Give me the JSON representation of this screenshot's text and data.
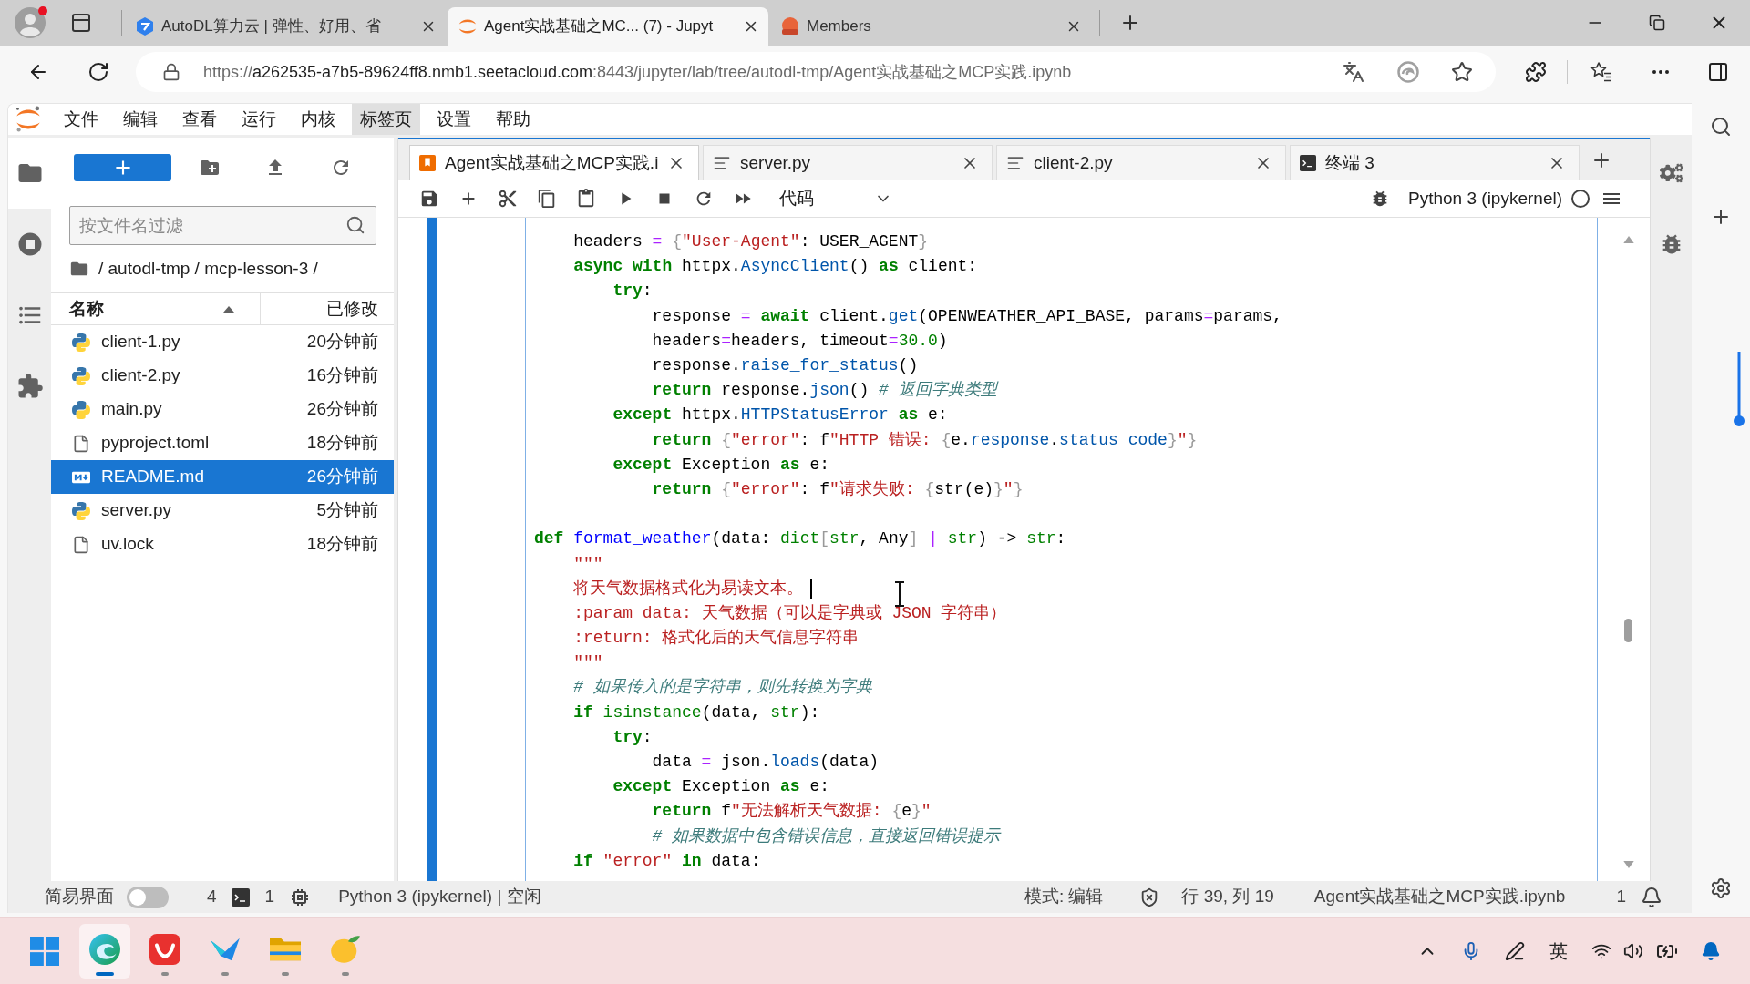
{
  "browser": {
    "tabs": [
      {
        "title": "AutoDL算力云 | 弹性、好用、省",
        "selected": false
      },
      {
        "title": "Agent实战基础之MC... (7) - Jupyt",
        "selected": true
      },
      {
        "title": "Members",
        "selected": false
      }
    ],
    "address": {
      "scheme": "https://",
      "host": "a262535-a7b5-89624ff8.nmb1.seetacloud.com",
      "path": ":8443/jupyter/lab/tree/autodl-tmp/Agent实战基础之MCP实践.ipynb"
    }
  },
  "menu": [
    {
      "label": "文件",
      "highlighted": false
    },
    {
      "label": "编辑",
      "highlighted": false
    },
    {
      "label": "查看",
      "highlighted": false
    },
    {
      "label": "运行",
      "highlighted": false
    },
    {
      "label": "内核",
      "highlighted": false
    },
    {
      "label": "标签页",
      "highlighted": true
    },
    {
      "label": "设置",
      "highlighted": false
    },
    {
      "label": "帮助",
      "highlighted": false
    }
  ],
  "activity_bar": [
    {
      "selected": true
    },
    {
      "selected": false
    },
    {
      "selected": false
    },
    {
      "selected": false
    }
  ],
  "file_browser": {
    "filter": {
      "placeholder": "按文件名过滤"
    },
    "breadcrumb": "/ autodl-tmp / mcp-lesson-3 /",
    "columns": [
      {
        "label": "名称",
        "sorted": true
      },
      {
        "label": "已修改",
        "sorted": false
      }
    ],
    "files": [
      {
        "name": "client-1.py",
        "modified": "20分钟前",
        "kind": "python",
        "selected": false
      },
      {
        "name": "client-2.py",
        "modified": "16分钟前",
        "kind": "python",
        "selected": false
      },
      {
        "name": "main.py",
        "modified": "26分钟前",
        "kind": "python",
        "selected": false
      },
      {
        "name": "pyproject.toml",
        "modified": "18分钟前",
        "kind": "text",
        "selected": false
      },
      {
        "name": "README.md",
        "modified": "26分钟前",
        "kind": "markdown",
        "selected": true
      },
      {
        "name": "server.py",
        "modified": "5分钟前",
        "kind": "python",
        "selected": false
      },
      {
        "name": "uv.lock",
        "modified": "18分钟前",
        "kind": "text",
        "selected": false
      }
    ]
  },
  "notebook": {
    "tabs": [
      {
        "title": "Agent实战基础之MCP实践.i",
        "kind": "notebook",
        "selected": true
      },
      {
        "title": "server.py",
        "kind": "text",
        "selected": false
      },
      {
        "title": "client-2.py",
        "kind": "text",
        "selected": false
      },
      {
        "title": "终端 3",
        "kind": "terminal",
        "selected": false
      }
    ],
    "toolbar": {
      "cell_type": "代码",
      "kernel": "Python 3 (ipykernel)",
      "kernel_busy": false
    },
    "cell": {
      "selected": true,
      "lines": [
        {
          "kind": "block",
          "children": [
            {
              "kind": "code",
              "caret": false,
              "tokens": [
                {
                  "kind": "plain",
                  "text": "headers "
                },
                {
                  "kind": "operator",
                  "text": "="
                },
                {
                  "kind": "bracket",
                  "text": " {"
                },
                {
                  "kind": "string",
                  "text": "\"User-Agent\""
                },
                {
                  "kind": "plain",
                  "text": ": USER_AGENT"
                },
                {
                  "kind": "bracket",
                  "text": "}"
                }
              ]
            },
            {
              "kind": "code",
              "caret": false,
              "tokens": [
                {
                  "kind": "keyword",
                  "text": "async with"
                },
                {
                  "kind": "plain",
                  "text": " httpx."
                },
                {
                  "kind": "property",
                  "text": "AsyncClient"
                },
                {
                  "kind": "plain",
                  "text": "() "
                },
                {
                  "kind": "keyword",
                  "text": "as"
                },
                {
                  "kind": "plain",
                  "text": " client:"
                }
              ],
              "children": [
                {
                  "kind": "code",
                  "caret": false,
                  "tokens": [
                    {
                      "kind": "keyword",
                      "text": "try"
                    },
                    {
                      "kind": "plain",
                      "text": ":"
                    }
                  ],
                  "children": [
                    {
                      "kind": "code",
                      "caret": false,
                      "tokens": [
                        {
                          "kind": "plain",
                          "text": "response "
                        },
                        {
                          "kind": "operator",
                          "text": "="
                        },
                        {
                          "kind": "keyword",
                          "text": " await"
                        },
                        {
                          "kind": "plain",
                          "text": " client."
                        },
                        {
                          "kind": "property",
                          "text": "get"
                        },
                        {
                          "kind": "plain",
                          "text": "(OPENWEATHER_API_BASE, params"
                        },
                        {
                          "kind": "operator",
                          "text": "="
                        },
                        {
                          "kind": "plain",
                          "text": "params,"
                        }
                      ]
                    },
                    {
                      "kind": "code",
                      "caret": false,
                      "tokens": [
                        {
                          "kind": "plain",
                          "text": "headers"
                        },
                        {
                          "kind": "operator",
                          "text": "="
                        },
                        {
                          "kind": "plain",
                          "text": "headers, timeout"
                        },
                        {
                          "kind": "operator",
                          "text": "="
                        },
                        {
                          "kind": "number",
                          "text": "30.0"
                        },
                        {
                          "kind": "plain",
                          "text": ")"
                        }
                      ]
                    },
                    {
                      "kind": "code",
                      "caret": false,
                      "tokens": [
                        {
                          "kind": "plain",
                          "text": "response."
                        },
                        {
                          "kind": "property",
                          "text": "raise_for_status"
                        },
                        {
                          "kind": "plain",
                          "text": "()"
                        }
                      ]
                    },
                    {
                      "kind": "code",
                      "caret": false,
                      "tokens": [
                        {
                          "kind": "keyword",
                          "text": "return"
                        },
                        {
                          "kind": "plain",
                          "text": " response."
                        },
                        {
                          "kind": "property",
                          "text": "json"
                        },
                        {
                          "kind": "plain",
                          "text": "() "
                        },
                        {
                          "kind": "comment",
                          "text": "# 返回字典类型"
                        }
                      ]
                    }
                  ]
                },
                {
                  "kind": "code",
                  "caret": false,
                  "tokens": [
                    {
                      "kind": "keyword",
                      "text": "except"
                    },
                    {
                      "kind": "plain",
                      "text": " httpx."
                    },
                    {
                      "kind": "property",
                      "text": "HTTPStatusError"
                    },
                    {
                      "kind": "keyword",
                      "text": " as"
                    },
                    {
                      "kind": "plain",
                      "text": " e:"
                    }
                  ],
                  "children": [
                    {
                      "kind": "code",
                      "caret": false,
                      "tokens": [
                        {
                          "kind": "keyword",
                          "text": "return"
                        },
                        {
                          "kind": "bracket",
                          "text": " {"
                        },
                        {
                          "kind": "string",
                          "text": "\"error\""
                        },
                        {
                          "kind": "plain",
                          "text": ": f"
                        },
                        {
                          "kind": "string",
                          "text": "\"HTTP 错误: "
                        },
                        {
                          "kind": "bracket",
                          "text": "{"
                        },
                        {
                          "kind": "plain",
                          "text": "e."
                        },
                        {
                          "kind": "property",
                          "text": "response"
                        },
                        {
                          "kind": "plain",
                          "text": "."
                        },
                        {
                          "kind": "property",
                          "text": "status_code"
                        },
                        {
                          "kind": "bracket",
                          "text": "}"
                        },
                        {
                          "kind": "string",
                          "text": "\""
                        },
                        {
                          "kind": "bracket",
                          "text": "}"
                        }
                      ]
                    }
                  ]
                },
                {
                  "kind": "code",
                  "caret": false,
                  "tokens": [
                    {
                      "kind": "keyword",
                      "text": "except"
                    },
                    {
                      "kind": "plain",
                      "text": " Exception "
                    },
                    {
                      "kind": "keyword",
                      "text": "as"
                    },
                    {
                      "kind": "plain",
                      "text": " e:"
                    }
                  ],
                  "children": [
                    {
                      "kind": "code",
                      "caret": false,
                      "tokens": [
                        {
                          "kind": "keyword",
                          "text": "return"
                        },
                        {
                          "kind": "bracket",
                          "text": " {"
                        },
                        {
                          "kind": "string",
                          "text": "\"error\""
                        },
                        {
                          "kind": "plain",
                          "text": ": f"
                        },
                        {
                          "kind": "string",
                          "text": "\"请求失败: "
                        },
                        {
                          "kind": "bracket",
                          "text": "{"
                        },
                        {
                          "kind": "plain",
                          "text": "str(e)"
                        },
                        {
                          "kind": "bracket",
                          "text": "}"
                        },
                        {
                          "kind": "string",
                          "text": "\""
                        },
                        {
                          "kind": "bracket",
                          "text": "}"
                        }
                      ]
                    }
                  ]
                }
              ]
            }
          ]
        },
        {
          "kind": "blank"
        },
        {
          "kind": "code",
          "caret": false,
          "tokens": [
            {
              "kind": "keyword",
              "text": "def"
            },
            {
              "kind": "definition",
              "text": " format_weather"
            },
            {
              "kind": "plain",
              "text": "(data: "
            },
            {
              "kind": "builtin",
              "text": "dict"
            },
            {
              "kind": "bracket",
              "text": "["
            },
            {
              "kind": "builtin",
              "text": "str"
            },
            {
              "kind": "plain",
              "text": ", Any"
            },
            {
              "kind": "bracket",
              "text": "]"
            },
            {
              "kind": "operator",
              "text": " |"
            },
            {
              "kind": "builtin",
              "text": " str"
            },
            {
              "kind": "plain",
              "text": ") -> "
            },
            {
              "kind": "builtin",
              "text": "str"
            },
            {
              "kind": "plain",
              "text": ":"
            }
          ],
          "children": [
            {
              "kind": "code",
              "caret": false,
              "tokens": [
                {
                  "kind": "string",
                  "text": "\"\"\""
                }
              ]
            },
            {
              "kind": "code",
              "caret": true,
              "tokens": [
                {
                  "kind": "string",
                  "text": "将天气数据格式化为易读文本。"
                }
              ]
            },
            {
              "kind": "code",
              "caret": false,
              "tokens": [
                {
                  "kind": "string",
                  "text": ":param data: 天气数据（可以是字典或 JSON 字符串）"
                }
              ]
            },
            {
              "kind": "code",
              "caret": false,
              "tokens": [
                {
                  "kind": "string",
                  "text": ":return: 格式化后的天气信息字符串"
                }
              ]
            },
            {
              "kind": "code",
              "caret": false,
              "tokens": [
                {
                  "kind": "string",
                  "text": "\"\"\""
                }
              ]
            },
            {
              "kind": "code",
              "caret": false,
              "tokens": [
                {
                  "kind": "comment",
                  "text": "# 如果传入的是字符串，则先转换为字典"
                }
              ]
            },
            {
              "kind": "code",
              "caret": false,
              "tokens": [
                {
                  "kind": "keyword",
                  "text": "if"
                },
                {
                  "kind": "builtin",
                  "text": " isinstance"
                },
                {
                  "kind": "plain",
                  "text": "(data, "
                },
                {
                  "kind": "builtin",
                  "text": "str"
                },
                {
                  "kind": "plain",
                  "text": "):"
                }
              ],
              "children": [
                {
                  "kind": "code",
                  "caret": false,
                  "tokens": [
                    {
                      "kind": "keyword",
                      "text": "try"
                    },
                    {
                      "kind": "plain",
                      "text": ":"
                    }
                  ],
                  "children": [
                    {
                      "kind": "code",
                      "caret": false,
                      "tokens": [
                        {
                          "kind": "plain",
                          "text": "data "
                        },
                        {
                          "kind": "operator",
                          "text": "="
                        },
                        {
                          "kind": "plain",
                          "text": " json."
                        },
                        {
                          "kind": "property",
                          "text": "loads"
                        },
                        {
                          "kind": "plain",
                          "text": "(data)"
                        }
                      ]
                    }
                  ]
                },
                {
                  "kind": "code",
                  "caret": false,
                  "tokens": [
                    {
                      "kind": "keyword",
                      "text": "except"
                    },
                    {
                      "kind": "plain",
                      "text": " Exception "
                    },
                    {
                      "kind": "keyword",
                      "text": "as"
                    },
                    {
                      "kind": "plain",
                      "text": " e:"
                    }
                  ],
                  "children": [
                    {
                      "kind": "code",
                      "caret": false,
                      "tokens": [
                        {
                          "kind": "keyword",
                          "text": "return"
                        },
                        {
                          "kind": "plain",
                          "text": " f"
                        },
                        {
                          "kind": "string",
                          "text": "\"无法解析天气数据: "
                        },
                        {
                          "kind": "bracket",
                          "text": "{"
                        },
                        {
                          "kind": "plain",
                          "text": "e"
                        },
                        {
                          "kind": "bracket",
                          "text": "}"
                        },
                        {
                          "kind": "string",
                          "text": "\""
                        }
                      ]
                    },
                    {
                      "kind": "code",
                      "caret": false,
                      "tokens": [
                        {
                          "kind": "comment",
                          "text": "# 如果数据中包含错误信息，直接返回错误提示"
                        }
                      ]
                    }
                  ]
                }
              ]
            },
            {
              "kind": "code",
              "caret": false,
              "tokens": [
                {
                  "kind": "keyword",
                  "text": "if"
                },
                {
                  "kind": "string",
                  "text": " \"error\""
                },
                {
                  "kind": "keyword",
                  "text": " in"
                },
                {
                  "kind": "plain",
                  "text": " data:"
                }
              ]
            }
          ]
        }
      ]
    }
  },
  "status_bar": {
    "simple_mode": {
      "label": "简易界面",
      "on": false
    },
    "terminals": "4",
    "kernels": "1",
    "kernel_status": "Python 3 (ipykernel) | 空闲",
    "mode": "模式: 编辑",
    "cursor": "行 39, 列 19",
    "file": "Agent实战基础之MCP实践.ipynb",
    "notifications": "1"
  },
  "taskbar": {
    "apps": [
      {
        "running": true,
        "selected": true
      },
      {
        "running": true,
        "selected": false
      },
      {
        "running": true,
        "selected": false
      },
      {
        "running": true,
        "selected": false
      },
      {
        "running": true,
        "selected": false
      }
    ],
    "input_method": "英"
  }
}
